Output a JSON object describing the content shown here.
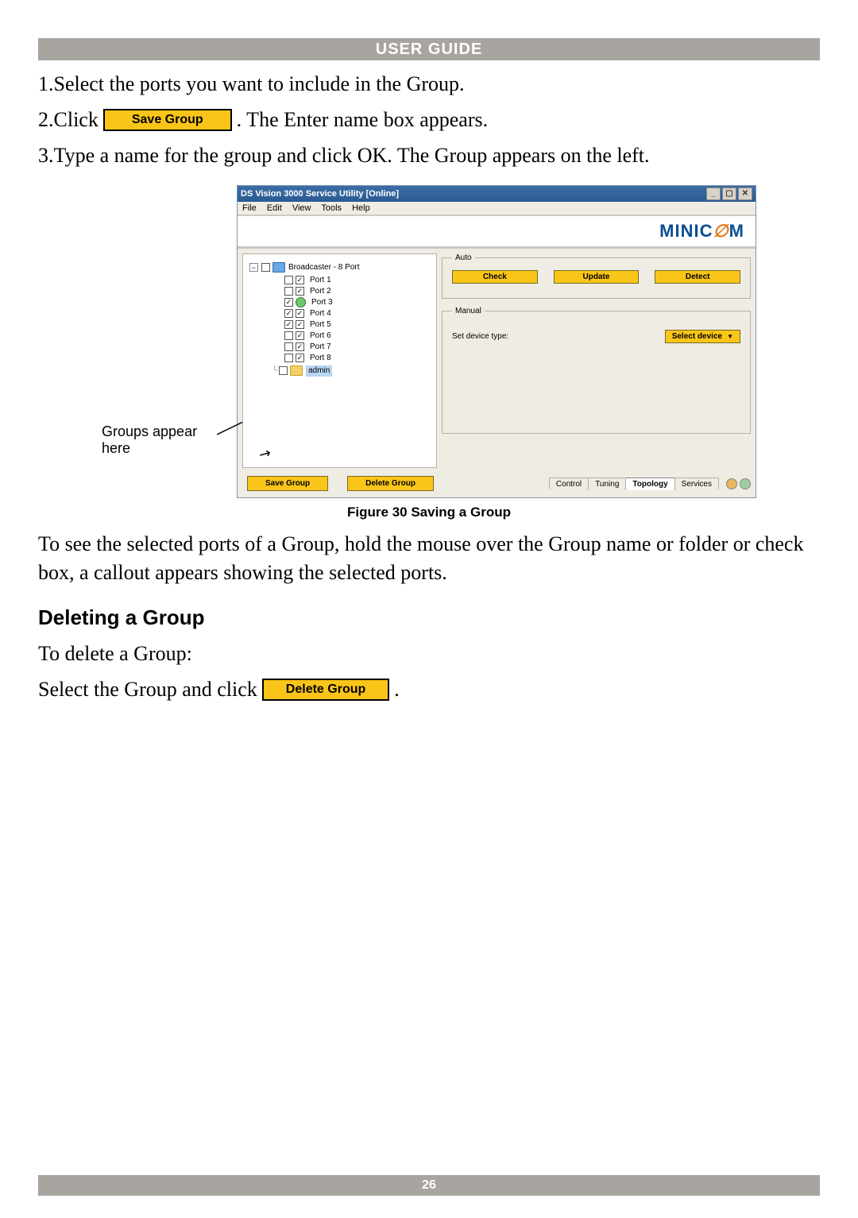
{
  "header": {
    "title": "USER GUIDE"
  },
  "steps": {
    "one": "1.Select the ports you want to include in the Group.",
    "two_prefix": "2.Click ",
    "save_group_btn": "Save Group",
    "two_suffix": ". The Enter name box appears.",
    "three": "3.Type a name for the group and click OK. The Group appears on the left."
  },
  "callout": {
    "line1": "Groups appear",
    "line2": "here"
  },
  "app": {
    "title": "DS Vision 3000 Service Utility [Online]",
    "menu": [
      "File",
      "Edit",
      "View",
      "Tools",
      "Help"
    ],
    "logo_left": "MINIC",
    "logo_right": "M",
    "tree": {
      "root": "Broadcaster - 8 Port",
      "ports": [
        {
          "label": "Port 1",
          "checked1": false,
          "checked2": true,
          "dot": false
        },
        {
          "label": "Port 2",
          "checked1": false,
          "checked2": true,
          "dot": false
        },
        {
          "label": "Port 3",
          "checked1": true,
          "checked2": false,
          "dot": true
        },
        {
          "label": "Port 4",
          "checked1": true,
          "checked2": true,
          "dot": false
        },
        {
          "label": "Port 5",
          "checked1": true,
          "checked2": true,
          "dot": false
        },
        {
          "label": "Port 6",
          "checked1": false,
          "checked2": true,
          "dot": false
        },
        {
          "label": "Port 7",
          "checked1": false,
          "checked2": true,
          "dot": false
        },
        {
          "label": "Port 8",
          "checked1": false,
          "checked2": true,
          "dot": false
        }
      ],
      "admin": "admin"
    },
    "auto": {
      "legend": "Auto",
      "check": "Check",
      "update": "Update",
      "detect": "Detect"
    },
    "manual": {
      "legend": "Manual",
      "label": "Set device type:",
      "select": "Select device"
    },
    "bottom": {
      "save": "Save Group",
      "delete": "Delete Group",
      "tabs": [
        "Control",
        "Tuning",
        "Topology",
        "Services"
      ],
      "active_tab": 2
    }
  },
  "caption": "Figure 30 Saving a Group",
  "para_after": "To see the selected ports of a Group, hold the mouse over the Group name or folder or check box, a callout appears showing the selected ports.",
  "section2_title": "Deleting a Group",
  "delete_intro": "To delete a Group:",
  "delete_sel_prefix": "Select the Group and click ",
  "delete_group_btn": "Delete Group",
  "delete_sel_suffix": ".",
  "page_number": "26"
}
